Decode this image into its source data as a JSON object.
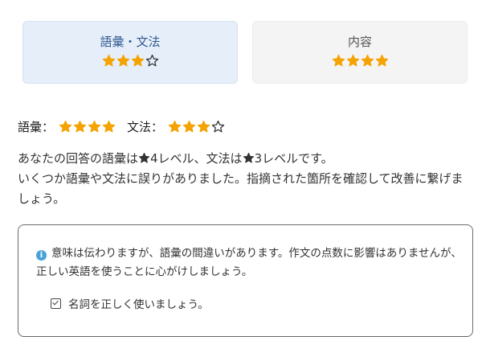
{
  "colors": {
    "star_filled": "#f5a300",
    "star_outline": "#333333",
    "tab_selected_bg": "#e6eefa",
    "tab_bg": "#f4f4f4",
    "info_icon": "#4aa3d8"
  },
  "tabs": [
    {
      "label": "語彙・文法",
      "rating": 3,
      "max": 4,
      "selected": true
    },
    {
      "label": "内容",
      "rating": 4,
      "max": 4,
      "selected": false
    }
  ],
  "ratings": {
    "vocab_label": "語彙：",
    "vocab_rating": 4,
    "grammar_label": "文法：",
    "grammar_rating": 3,
    "max": 4
  },
  "summary": {
    "line1_a": "あなたの回答の語彙は",
    "line1_b": "4レベル、文法は",
    "line1_c": "3レベルです。",
    "line2": "いくつか語彙や文法に誤りがありました。指摘された箇所を確認して改善に繋げましょう。"
  },
  "feedback": {
    "info_icon": "info-icon",
    "info_text": "意味は伝わりますが、語彙の間違いがあります。作文の点数に影響はありませんが、正しい英語を使うことに心がけしましょう。",
    "check_icon": "checkbox-icon",
    "check_text": "名詞を正しく使いましょう。"
  }
}
